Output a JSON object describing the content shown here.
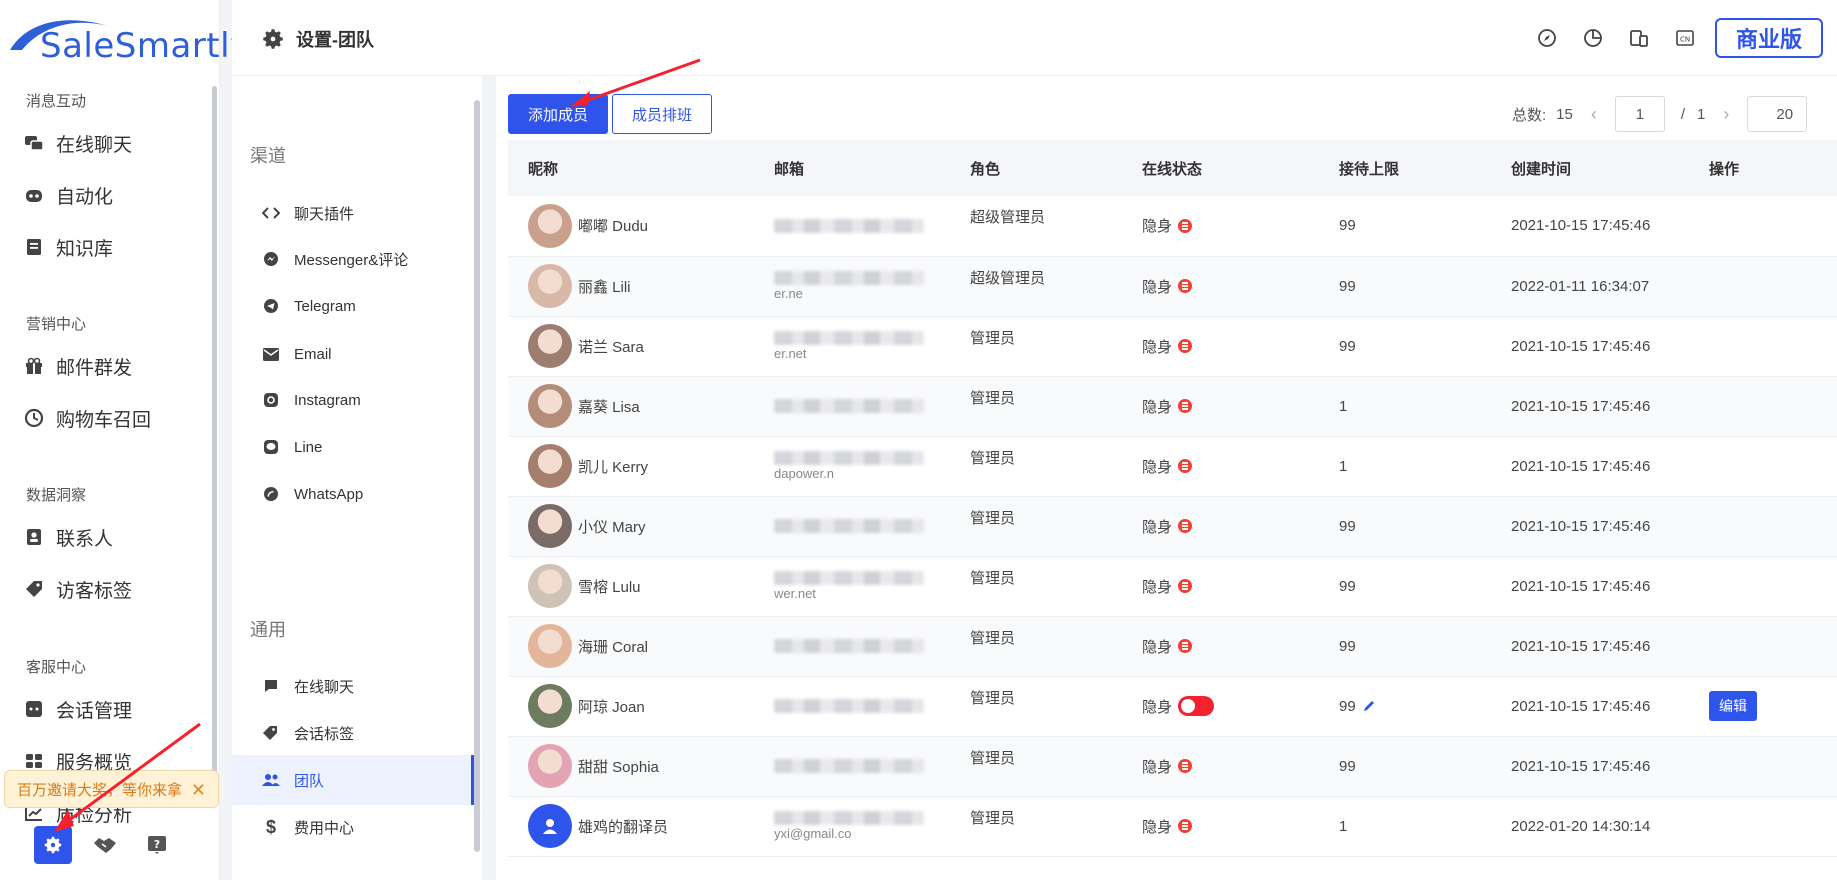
{
  "brand": {
    "logo_text": "SaleSmartly"
  },
  "nav": {
    "sections": [
      {
        "title": "消息互动",
        "items": [
          "在线聊天",
          "自动化",
          "知识库"
        ]
      },
      {
        "title": "营销中心",
        "items": [
          "邮件群发",
          "购物车召回"
        ]
      },
      {
        "title": "数据洞察",
        "items": [
          "联系人",
          "访客标签"
        ]
      },
      {
        "title": "客服中心",
        "items": [
          "会话管理",
          "服务概览",
          "质检分析"
        ]
      }
    ],
    "promo_text": "百万邀请大奖，等你来拿",
    "promo_close": "✕"
  },
  "header": {
    "title": "设置-团队",
    "plan_label": "商业版"
  },
  "settings": {
    "group_channels": "渠道",
    "channels": [
      "聊天插件",
      "Messenger&评论",
      "Telegram",
      "Email",
      "Instagram",
      "Line",
      "WhatsApp"
    ],
    "group_general": "通用",
    "general": [
      "在线聊天",
      "会话标签",
      "团队",
      "费用中心"
    ]
  },
  "toolbar": {
    "add_member": "添加成员",
    "schedule": "成员排班"
  },
  "pager": {
    "total_label": "总数:",
    "total": "15",
    "page": "1",
    "sep": "/",
    "pages": "1",
    "page_size": "20"
  },
  "table": {
    "headers": [
      "昵称",
      "邮箱",
      "角色",
      "在线状态",
      "接待上限",
      "创建时间",
      "操作"
    ],
    "rows": [
      {
        "nick": "嘟嘟 Dudu",
        "email_suffix": "",
        "role": "超级管理员",
        "status": "隐身",
        "limit": "99",
        "created": "2021-10-15 17:45:46"
      },
      {
        "nick": "丽鑫 Lili",
        "email_suffix": "er.ne",
        "role": "超级管理员",
        "status": "隐身",
        "limit": "99",
        "created": "2022-01-11 16:34:07"
      },
      {
        "nick": "诺兰 Sara",
        "email_suffix": "er.net",
        "role": "管理员",
        "status": "隐身",
        "limit": "99",
        "created": "2021-10-15 17:45:46"
      },
      {
        "nick": "嘉葵 Lisa",
        "email_suffix": "",
        "role": "管理员",
        "status": "隐身",
        "limit": "1",
        "created": "2021-10-15 17:45:46"
      },
      {
        "nick": "凯儿 Kerry",
        "email_suffix": "dapower.n",
        "role": "管理员",
        "status": "隐身",
        "limit": "1",
        "created": "2021-10-15 17:45:46"
      },
      {
        "nick": "小仪 Mary",
        "email_suffix": "",
        "role": "管理员",
        "status": "隐身",
        "limit": "99",
        "created": "2021-10-15 17:45:46"
      },
      {
        "nick": "雪榕 Lulu",
        "email_suffix": "wer.net",
        "role": "管理员",
        "status": "隐身",
        "limit": "99",
        "created": "2021-10-15 17:45:46"
      },
      {
        "nick": "海珊 Coral",
        "email_suffix": "",
        "role": "管理员",
        "status": "隐身",
        "limit": "99",
        "created": "2021-10-15 17:45:46"
      },
      {
        "nick": "阿琼 Joan",
        "email_suffix": "",
        "role": "管理员",
        "status": "隐身",
        "limit": "99",
        "created": "2021-10-15 17:45:46",
        "action": "编辑"
      },
      {
        "nick": "甜甜 Sophia",
        "email_suffix": "",
        "role": "管理员",
        "status": "隐身",
        "limit": "99",
        "created": "2021-10-15 17:45:46"
      },
      {
        "nick": "雄鸡的翻译员",
        "email_suffix": "yxi@gmail.co",
        "role": "管理员",
        "status": "隐身",
        "limit": "1",
        "created": "2022-01-20 14:30:14"
      }
    ]
  },
  "colors": {
    "accent": "#2f54eb",
    "danger": "#f04134",
    "promo_bg": "#fff2d6"
  }
}
